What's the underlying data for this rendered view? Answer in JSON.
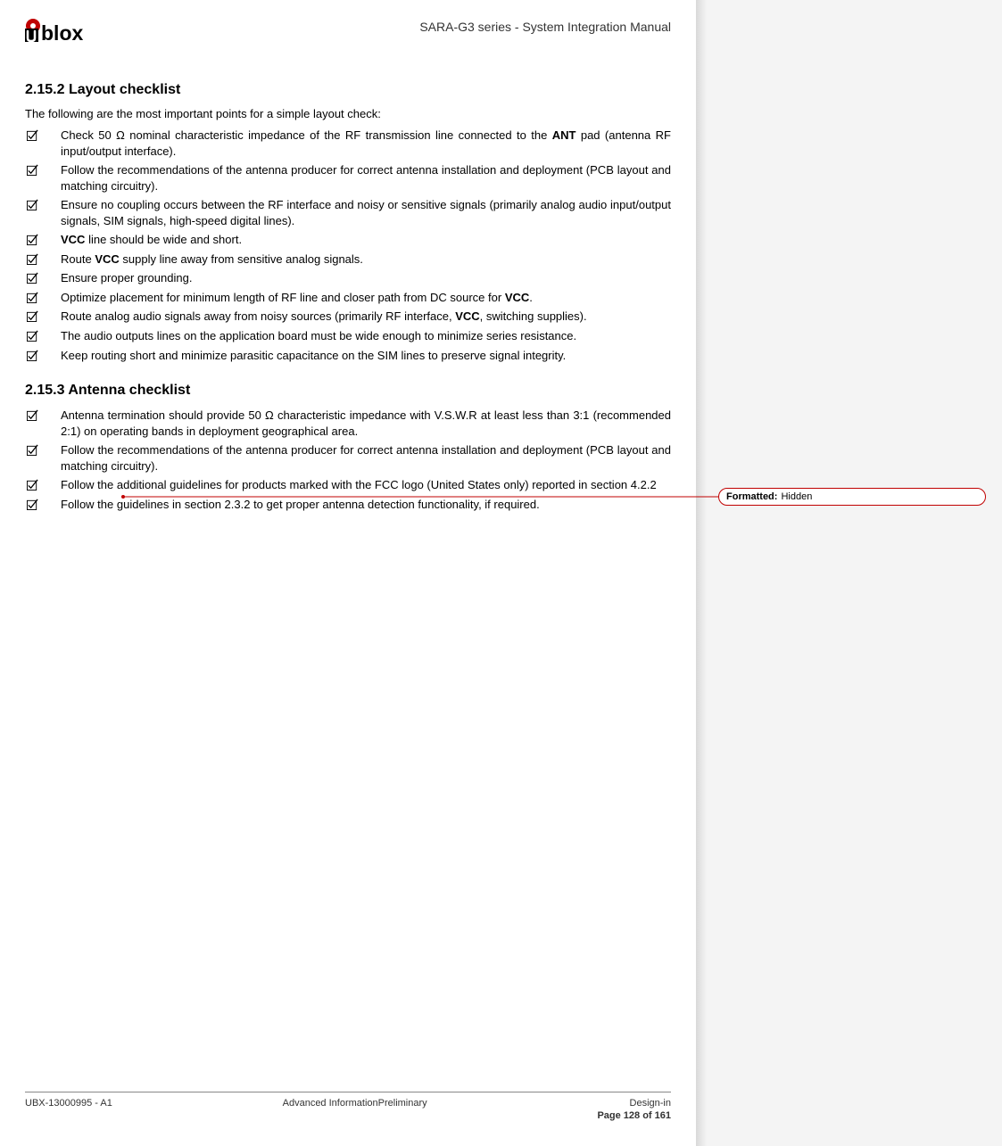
{
  "header": {
    "doc_title": "SARA-G3 series - System Integration Manual"
  },
  "sections": {
    "layout": {
      "number": "2.15.2",
      "title": "Layout checklist",
      "intro": "The following are the most important points for a simple layout check:",
      "items": [
        {
          "pre": "Check 50 Ω nominal characteristic impedance of the RF transmission line connected to the ",
          "bold1": "ANT",
          "post1": " pad (antenna RF input/output interface)."
        },
        {
          "plain": "Follow the recommendations of the antenna producer for correct antenna installation and deployment (PCB layout and matching circuitry)."
        },
        {
          "plain": "Ensure no coupling occurs between the RF interface and noisy or sensitive signals (primarily analog audio input/output signals, SIM signals, high-speed digital lines)."
        },
        {
          "bold_lead": "VCC",
          "post_lead": " line should be wide and short."
        },
        {
          "pre": "Route ",
          "bold1": "VCC",
          "post1": " supply line away from sensitive analog signals."
        },
        {
          "plain": "Ensure proper grounding."
        },
        {
          "pre": "Optimize placement for minimum length of RF line and closer path from DC source for ",
          "bold1": "VCC",
          "post1": "."
        },
        {
          "pre": "Route analog audio signals away from noisy sources (primarily RF interface, ",
          "bold1": "VCC",
          "post1": ", switching supplies)."
        },
        {
          "plain": "The audio outputs lines on the application board must be wide enough to minimize series resistance."
        },
        {
          "plain": "Keep routing short and minimize parasitic capacitance on the SIM lines to preserve signal integrity."
        }
      ]
    },
    "antenna": {
      "number": "2.15.3",
      "title": "Antenna checklist",
      "items": [
        {
          "plain": "Antenna termination should provide 50 Ω characteristic impedance with V.S.W.R at least less than 3:1 (recommended 2:1) on operating bands in deployment geographical area."
        },
        {
          "plain": "Follow the recommendations of the antenna producer for correct antenna installation and deployment (PCB layout and matching circuitry)."
        },
        {
          "pre": "Follow the additional guidelines for products marked with the FCC logo (United States only) reported in section ",
          "link": "4.2.2"
        },
        {
          "plain": "Follow the guidelines in section 2.3.2 to get proper antenna detection functionality, if required."
        }
      ]
    }
  },
  "callout": {
    "label": "Formatted:",
    "value": "Hidden"
  },
  "footer": {
    "left": "UBX-13000995 - A1",
    "mid": "Advanced InformationPreliminary",
    "right_top": "Design-in",
    "right_page": "Page 128 of 161"
  }
}
